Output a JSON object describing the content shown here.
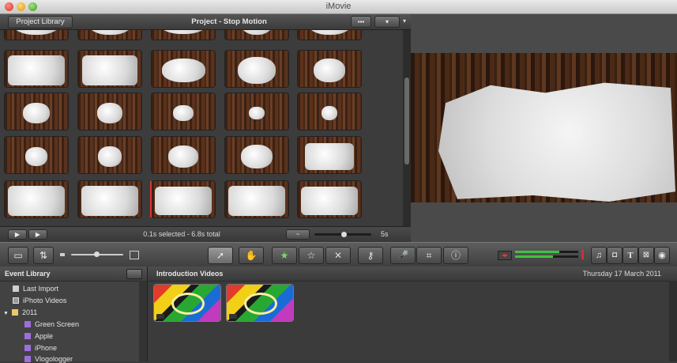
{
  "window": {
    "title": "iMovie"
  },
  "project_header": {
    "library_button": "Project Library",
    "title": "Project - Stop Motion"
  },
  "project_footer": {
    "status": "0.1s selected - 6.8s total",
    "zoom_value": "5s"
  },
  "event_library": {
    "title": "Event Library",
    "items": [
      {
        "label": "Last Import",
        "icon": "import-icon"
      },
      {
        "label": "iPhoto Videos",
        "icon": "iphoto-icon"
      },
      {
        "label": "2011",
        "icon": "folder-icon"
      },
      {
        "label": "Green Screen",
        "icon": "event-icon"
      },
      {
        "label": "Apple",
        "icon": "event-icon"
      },
      {
        "label": "iPhone",
        "icon": "event-icon"
      },
      {
        "label": "Vlogologger",
        "icon": "event-icon"
      }
    ]
  },
  "events_panel": {
    "title": "Introduction Videos",
    "date": "Thursday 17 March 2011"
  },
  "toolbar": {
    "icons": [
      "camera-icon",
      "swap-icon",
      "thumbnail-size-slider",
      "select-arrow-icon",
      "hand-icon",
      "favorite-star-icon",
      "unmark-star-icon",
      "reject-x-icon",
      "keyword-icon",
      "microphone-icon",
      "crop-icon",
      "info-icon",
      "audio-meter",
      "music-icon",
      "photo-icon",
      "title-icon",
      "transition-icon",
      "map-icon"
    ]
  }
}
